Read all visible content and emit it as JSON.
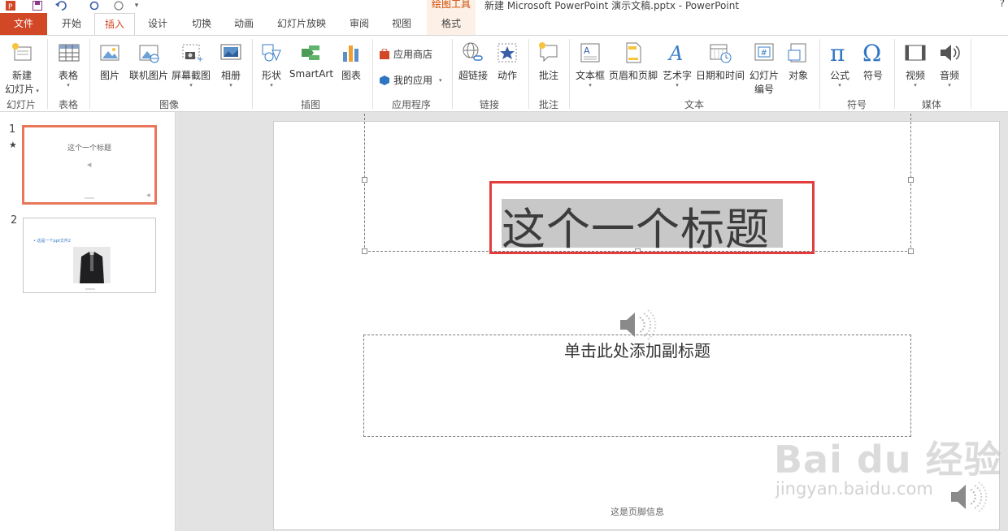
{
  "titlebar": {
    "contextual_tab_group": "绘图工具",
    "document_title": "新建 Microsoft PowerPoint 演示文稿.pptx - PowerPoint",
    "help": "?"
  },
  "tabs": [
    {
      "label": "文件"
    },
    {
      "label": "开始"
    },
    {
      "label": "插入",
      "active": true
    },
    {
      "label": "设计"
    },
    {
      "label": "切换"
    },
    {
      "label": "动画"
    },
    {
      "label": "幻灯片放映"
    },
    {
      "label": "审阅"
    },
    {
      "label": "视图"
    },
    {
      "label": "格式"
    }
  ],
  "ribbon": {
    "groups": {
      "slides": "幻灯片",
      "tables": "表格",
      "images": "图像",
      "illustrations": "插图",
      "apps": "应用程序",
      "links": "链接",
      "comments": "批注",
      "text": "文本",
      "symbols": "符号",
      "media": "媒体"
    },
    "buttons": {
      "new_slide_1": "新建",
      "new_slide_2": "幻灯片",
      "table": "表格",
      "picture": "图片",
      "online_picture": "联机图片",
      "screenshot": "屏幕截图",
      "album": "相册",
      "shapes": "形状",
      "smartart": "SmartArt",
      "chart": "图表",
      "store": "应用商店",
      "my_apps": "我的应用",
      "hyperlink": "超链接",
      "action": "动作",
      "comment": "批注",
      "textbox": "文本框",
      "header_footer": "页眉和页脚",
      "wordart": "艺术字",
      "datetime": "日期和时间",
      "slide_number_1": "幻灯片",
      "slide_number_2": "编号",
      "object": "对象",
      "equation": "公式",
      "symbol": "符号",
      "video": "视频",
      "audio": "音频"
    }
  },
  "thumbnails": [
    {
      "number": "1",
      "title": "这个一个标题"
    },
    {
      "number": "2",
      "text": "• 这是一个ppt文件2"
    }
  ],
  "slide": {
    "title": "这个一个标题",
    "subtitle_placeholder": "单击此处添加副标题",
    "footer": "这是页脚信息"
  },
  "watermark": {
    "brand": "Bai du 经验",
    "url": "jingyan.baidu.com"
  },
  "colors": {
    "accent": "#d24726",
    "selection_box": "#e23c3c",
    "title_highlight": "#c8c8c8"
  }
}
